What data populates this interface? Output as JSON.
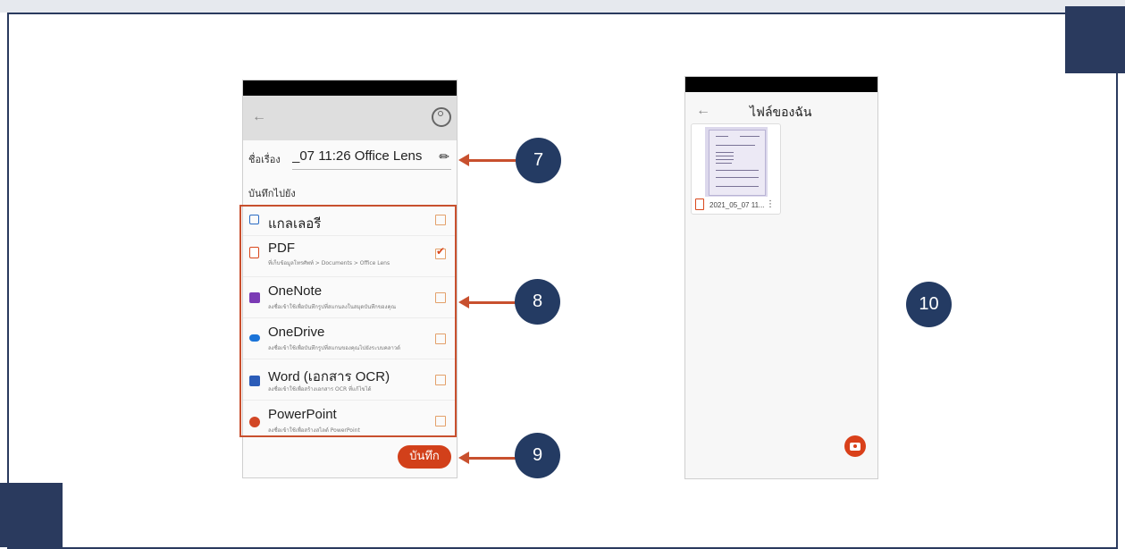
{
  "callouts": [
    "7",
    "8",
    "9",
    "10"
  ],
  "phone1": {
    "title_label": "ชื่อเรื่อง",
    "title_value": "_07 11:26 Office Lens",
    "save_to_label": "บันทึกไปยัง",
    "destinations": [
      {
        "name": "แกลเลอรี",
        "desc": "",
        "checked": false,
        "icon": "gallery-icon",
        "color": "#2b6cc4"
      },
      {
        "name": "PDF",
        "desc": "ที่เก็บข้อมูลโทรศัพท์ > Documents > Office Lens",
        "checked": true,
        "icon": "pdf-icon",
        "color": "#d9481c"
      },
      {
        "name": "OneNote",
        "desc": "ลงชื่อเข้าใช้เพื่อบันทึกรูปที่สแกนลงในสมุดบันทึกของคุณ",
        "checked": false,
        "icon": "onenote-icon",
        "color": "#7b3bb5"
      },
      {
        "name": "OneDrive",
        "desc": "ลงชื่อเข้าใช้เพื่อบันทึกรูปที่สแกนของคุณไปยังระบบคลาวด์",
        "checked": false,
        "icon": "onedrive-icon",
        "color": "#1a73d8"
      },
      {
        "name": "Word (เอกสาร OCR)",
        "desc": "ลงชื่อเข้าใช้เพื่อสร้างเอกสาร OCR ที่แก้ไขได้",
        "checked": false,
        "icon": "word-icon",
        "color": "#2b5cb8"
      },
      {
        "name": "PowerPoint",
        "desc": "ลงชื่อเข้าใช้เพื่อสร้างสไลด์ PowerPoint",
        "checked": false,
        "icon": "powerpoint-icon",
        "color": "#d24726"
      }
    ],
    "save_button": "บันทึก"
  },
  "phone2": {
    "title": "ไฟล์ของฉัน",
    "file_name": "2021_05_07 11..."
  },
  "colors": {
    "accent": "#d2401a",
    "callout": "#243b63",
    "frame": "#2a3a5e",
    "arrow": "#c8502e"
  }
}
